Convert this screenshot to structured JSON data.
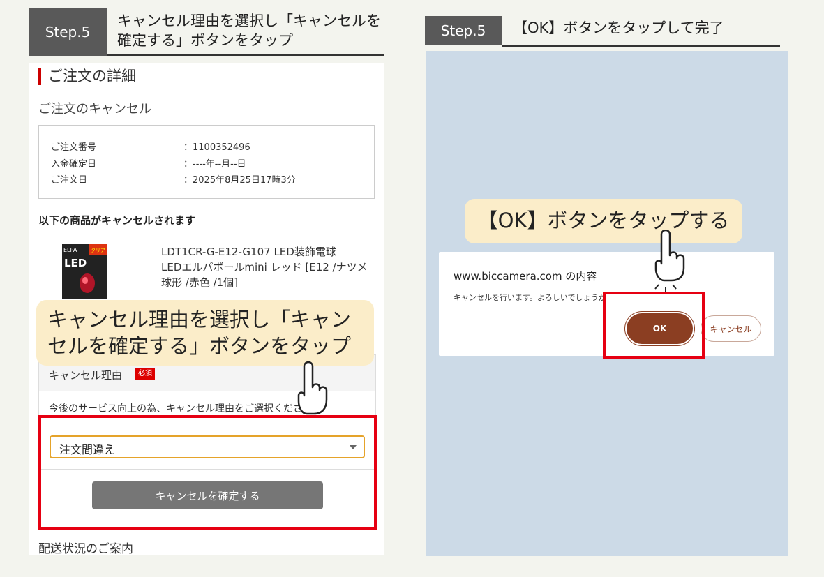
{
  "left": {
    "step_badge": "Step.5",
    "step_title": "キャンセル理由を選択し「キャンセルを\n確定する」ボタンをタップ",
    "page_title": "ご注文の詳細",
    "sub_heading": "ご注文のキャンセル",
    "order_info": [
      {
        "label": "ご注文番号",
        "value": "：1100352496"
      },
      {
        "label": "入金確定日",
        "value": "：----年--月--日"
      },
      {
        "label": "ご注文日",
        "value": "：2025年8月25日17時3分"
      }
    ],
    "cancel_items_heading": "以下の商品がキャンセルされます",
    "product": {
      "name": "LDT1CR-G-E12-G107 LED装飾電球\nLEDエルパボールmini レッド [E12 /ナツメ球形 /赤色 /1個]",
      "image_brand": "ELPA",
      "image_label": "LED",
      "image_tag": "クリア"
    },
    "callout": "キャンセル理由を選択し「キャンセルを確定する」ボタンをタップ",
    "reason": {
      "title": "キャンセル理由",
      "required_badge": "必須",
      "description": "今後のサービス向上の為、キャンセル理由をご選択ください。",
      "selected": "注文間違え",
      "confirm_button": "キャンセルを確定する"
    },
    "shipping_status": "配送状況のご案内"
  },
  "right": {
    "step_badge": "Step.5",
    "step_title": "【OK】ボタンをタップして完了",
    "callout": "【OK】ボタンをタップする",
    "dialog": {
      "title": "www.biccamera.com の内容",
      "message": "キャンセルを行います。よろしいでしょうか",
      "ok_button": "OK",
      "cancel_button": "キャンセル"
    }
  },
  "colors": {
    "highlight": "#e60012",
    "callout_bg": "#fbedc9",
    "ok_button": "#8b3e22",
    "select_border": "#e5a32a",
    "dialog_backdrop": "#ccdae7"
  },
  "icons": [
    "tap-hand-icon",
    "select-caret-icon"
  ]
}
